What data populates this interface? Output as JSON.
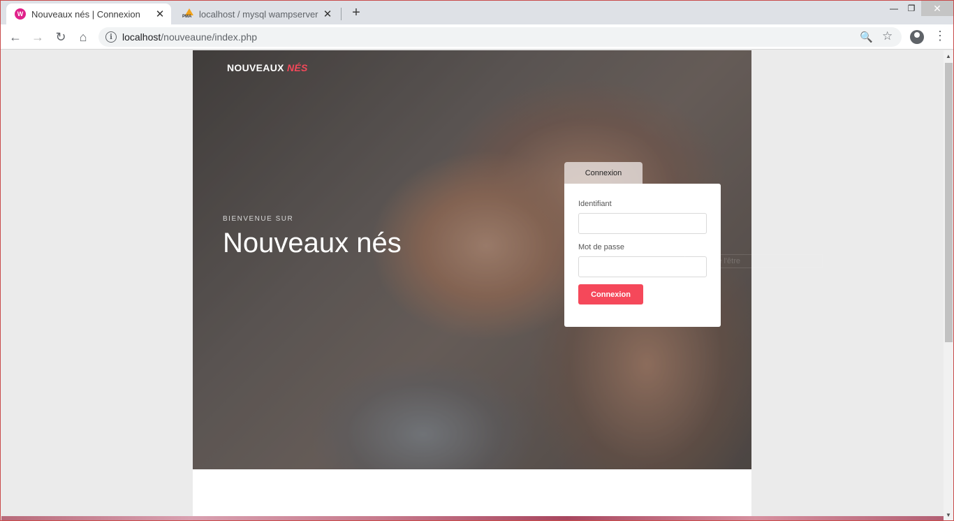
{
  "browser": {
    "tabs": [
      {
        "title": "Nouveaux nés | Connexion",
        "icon": "wampserver-icon",
        "active": true
      },
      {
        "title": "localhost / mysql wampserver / n",
        "icon": "phpmyadmin-icon",
        "active": false
      }
    ],
    "new_tab_glyph": "+",
    "url_host": "localhost",
    "url_path": "/nouveaune/index.php"
  },
  "page": {
    "logo_main": "NOUVEAUX",
    "logo_accent": "NÉS",
    "welcome": "BIENVENUE SUR",
    "title": "Nouveaux nés",
    "login": {
      "tab_label": "Connexion",
      "username_label": "Identifiant",
      "password_label": "Mot de passe",
      "submit_label": "Connexion"
    },
    "ghost_field_text": "... de l'être"
  },
  "colors": {
    "accent": "#f5485a",
    "tab_bar": "#dee1e6",
    "page_background": "#ebebeb"
  }
}
